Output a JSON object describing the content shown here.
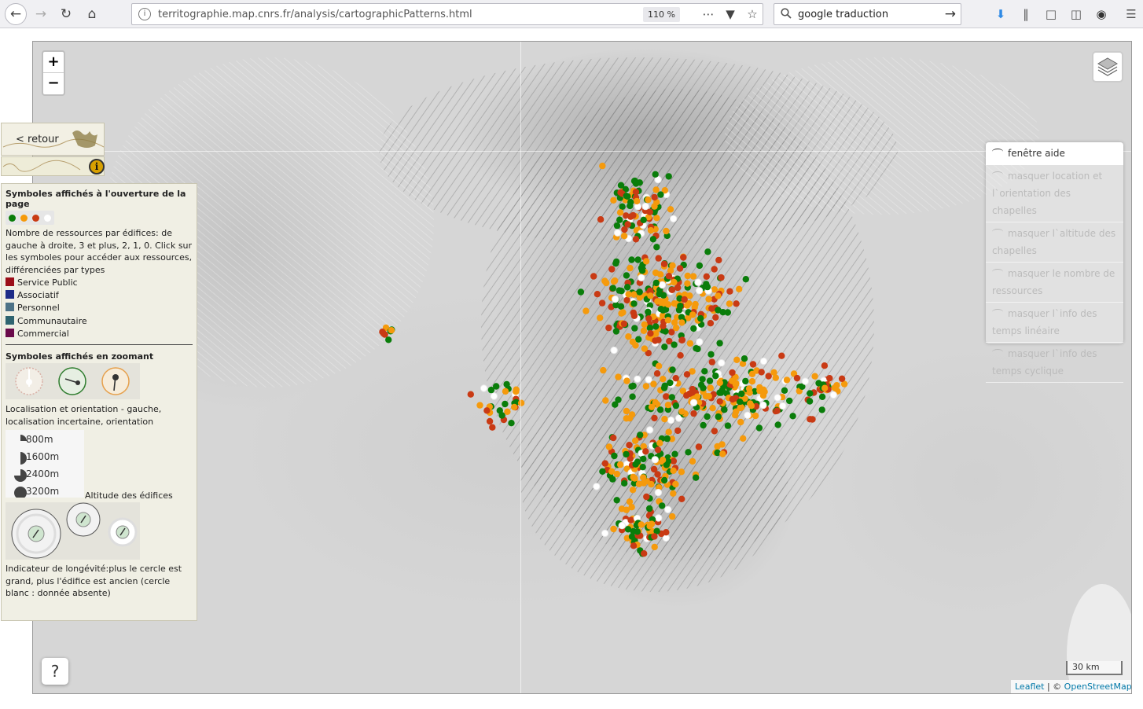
{
  "browser": {
    "url": "territographie.map.cnrs.fr/analysis/cartographicPatterns.html",
    "url_host": "territographie.map.cnrs.fr",
    "zoom_level": "110 %",
    "search_text": "google traduction"
  },
  "map": {
    "zoom_in_label": "+",
    "zoom_out_label": "−",
    "help_button_label": "?",
    "scale_label": "30 km",
    "attribution_leaflet": "Leaflet",
    "attribution_separator": " | © ",
    "attribution_osm": "OpenStreetMap",
    "marker_colors": {
      "three_plus": "#0a7d0a",
      "two": "#f59a0c",
      "one": "#c93a14",
      "zero": "#ffffff"
    },
    "marker_counts_note": "approx. 900 chapel markers in a dense cluster",
    "help_panel": {
      "items": [
        {
          "label": "fenêtre aide"
        },
        {
          "label": "masquer location et l`orientation des chapelles"
        },
        {
          "label": "masquer l`altitude des chapelles"
        },
        {
          "label": "masquer le nombre de ressources"
        },
        {
          "label": "masquer l`info des temps linéaire"
        },
        {
          "label": "masquer l`info des temps cyclique"
        }
      ]
    }
  },
  "side": {
    "retour_label": "< retour",
    "info_label": "i"
  },
  "legend": {
    "title_opening": "Symboles affichés à l'ouverture de la page",
    "resources_text": "Nombre de ressources par édifices: de gauche à droite, 3 et plus, 2, 1, 0. Click sur les symboles pour accéder aux ressources, différenciées par types",
    "types": [
      {
        "label": "Service Public",
        "color": "#9b0d18"
      },
      {
        "label": "Associatif",
        "color": "#1d2b88"
      },
      {
        "label": "Personnel",
        "color": "#4d7287"
      },
      {
        "label": "Communautaire",
        "color": "#2f6470"
      },
      {
        "label": "Commercial",
        "color": "#6a0a4a"
      }
    ],
    "title_zoom": "Symboles affichés en zoomant",
    "location_text": "Localisation et orientation - gauche, localisation incertaine, orientation inconnue",
    "altitudes": [
      "800m",
      "1600m",
      "2400m",
      "3200m"
    ],
    "altitude_title": "Altitude des édifices",
    "longevity_text": "Indicateur de longévité:plus le cercle est grand, plus l'édifice est ancien (cercle blanc : donnée absente)"
  }
}
